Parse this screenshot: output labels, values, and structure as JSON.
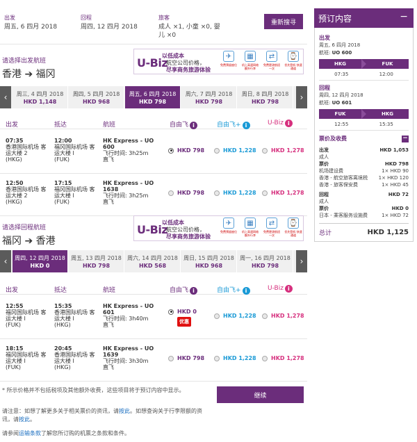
{
  "summary": {
    "depart_label": "出发",
    "depart_value": "周五, 6 四月 2018",
    "return_label": "回程",
    "return_value": "周四, 12 四月 2018",
    "pax_label": "旅客",
    "pax_value_1": "成人 ×1, 小童 ×0, 婴",
    "pax_value_2": "儿 ×0",
    "research_button": "重新搜寻"
  },
  "ad": {
    "brand": "U-Biz",
    "line1": "以低成本",
    "line2": "航空公司价格，",
    "line3": "尽享商务旅游体验",
    "badges": [
      {
        "icon": "✈",
        "text": "免费预留座位"
      },
      {
        "icon": "▦",
        "text": "机上高速网络 额外行李"
      },
      {
        "icon": "⇄",
        "text": "免费更改航班 一次"
      },
      {
        "icon": "⌚",
        "text": "优先登机 快速通道"
      }
    ]
  },
  "outbound": {
    "subtitle": "请选择出发航班",
    "from": "香港",
    "arrow": "➔",
    "to": "福冈",
    "dates": [
      {
        "date": "周三, 4 四月 2018",
        "price": "HKD 1,148"
      },
      {
        "date": "周四, 5 四月 2018",
        "price": "HKD 968"
      },
      {
        "date": "周五, 6 四月 2018",
        "price": "HKD 798"
      },
      {
        "date": "周六, 7 四月 2018",
        "price": "HKD 798"
      },
      {
        "date": "周日, 8 四月 2018",
        "price": "HKD 798"
      }
    ],
    "flights": [
      {
        "dep_time": "07:35",
        "dep_ap1": "香港国际机场 客",
        "dep_ap2": "运大楼 2",
        "dep_code": "(HKG)",
        "arr_time": "12:00",
        "arr_ap1": "福冈国际机场 客",
        "arr_ap2": "运大楼 I",
        "arr_code": "(FUK)",
        "fl1": "HK Express - UO",
        "fl2": "600",
        "duration": "飞行时间: 3h25m",
        "stops": "直飞",
        "fare1": "HKD 798",
        "fare2": "HKD 1,228",
        "fare3": "HKD 1,278"
      },
      {
        "dep_time": "12:50",
        "dep_ap1": "香港国际机场 客",
        "dep_ap2": "运大楼 2",
        "dep_code": "(HKG)",
        "arr_time": "17:15",
        "arr_ap1": "福冈国际机场 客",
        "arr_ap2": "运大楼 I",
        "arr_code": "(FUK)",
        "fl1": "HK Express - UO",
        "fl2": "1638",
        "duration": "飞行时间: 3h25m",
        "stops": "直飞",
        "fare1": "HKD 798",
        "fare2": "HKD 1,228",
        "fare3": "HKD 1,278"
      }
    ]
  },
  "inbound": {
    "subtitle": "请选择回程航班",
    "from": "福冈",
    "arrow": "➔",
    "to": "香港",
    "dates": [
      {
        "date": "周四, 12 四月 2018",
        "price": "HKD 0"
      },
      {
        "date": "周五, 13 四月 2018",
        "price": "HKD 798"
      },
      {
        "date": "周六, 14 四月 2018",
        "price": "HKD 568"
      },
      {
        "date": "周日, 15 四月 2018",
        "price": "HKD 968"
      },
      {
        "date": "周一, 16 四月 2018",
        "price": "HKD 798"
      }
    ],
    "flights": [
      {
        "dep_time": "12:55",
        "dep_ap1": "福冈国际机场 客",
        "dep_ap2": "运大楼 I",
        "dep_code": "(FUK)",
        "arr_time": "15:35",
        "arr_ap1": "香港国际机场 客",
        "arr_ap2": "运大楼 I",
        "arr_code": "(HKG)",
        "fl1": "HK Express - UO",
        "fl2": "601",
        "duration": "飞行时间: 3h40m",
        "stops": "直飞",
        "fare1": "HKD 0",
        "fare2": "HKD 1,228",
        "fare3": "HKD 1,278",
        "promo": "优惠"
      },
      {
        "dep_time": "18:15",
        "dep_ap1": "福冈国际机场 客",
        "dep_ap2": "运大楼 I",
        "dep_code": "(FUK)",
        "arr_time": "20:45",
        "arr_ap1": "香港国际机场 客",
        "arr_ap2": "运大楼 I",
        "arr_code": "(HKG)",
        "fl1": "HK Express - UO",
        "fl2": "1639",
        "duration": "飞行时间: 3h30m",
        "stops": "直飞",
        "fare1": "HKD 798",
        "fare2": "HKD 1,228",
        "fare3": "HKD 1,278"
      }
    ]
  },
  "table_headers": {
    "depart": "出发",
    "arrive": "抵达",
    "flight": "航班",
    "fare1": "自由飞",
    "fare2": "自由飞+",
    "fare3": "U-Biz",
    "info": "i"
  },
  "footer": {
    "note1": "* 所示价格并不包括税项及其他额外收费，这些项目将于预订内容中显示。",
    "note2a": "请注意：如想了解更多关于相关票价的资讯，请",
    "note2_link1": "按此",
    "note2b": "。如想查询关于行李限额的资讯，请",
    "note2_link2": "按此",
    "note2c": "。",
    "note3a": "请参阅",
    "note3_link": "运输条款",
    "note3b": "了解您所订购的机票之条款和条件。",
    "continue_button": "继续"
  },
  "sidebar": {
    "title": "预订内容",
    "minimize": "−",
    "out_title": "出发",
    "out_date": "周五, 6 四月 2018",
    "out_flight_label": "航班:",
    "out_flight": "UO 600",
    "out_from": "HKG",
    "out_to": "FUK",
    "out_dep": "07:35",
    "out_arr": "12:00",
    "ret_title": "回程",
    "ret_date": "周四, 12 四月 2018",
    "ret_flight_label": "航班:",
    "ret_flight": "UO 601",
    "ret_from": "FUK",
    "ret_to": "HKG",
    "ret_dep": "12:55",
    "ret_arr": "15:35",
    "fares_title": "票价及收费",
    "fares_toggle": "−",
    "out_fare_label": "出发",
    "out_fare_total": "HKD 1,053",
    "adult": "成人",
    "fare_label": "票价",
    "out_fare": "HKD 798",
    "fee1_label": "机场建设费",
    "fee1": "1× HKD 90",
    "fee2_label": "香港 - 航空旅客离境税",
    "fee2": "1× HKD 120",
    "fee3_label": "香港 - 旅客保安费",
    "fee3": "1× HKD 45",
    "ret_fare_label": "回程",
    "ret_fare_total": "HKD 72",
    "ret_fare": "HKD 0",
    "fee4_label": "日本 - 乘客服务设施费",
    "fee4": "1× HKD 72",
    "total_label": "总计",
    "total": "HKD 1,125"
  }
}
